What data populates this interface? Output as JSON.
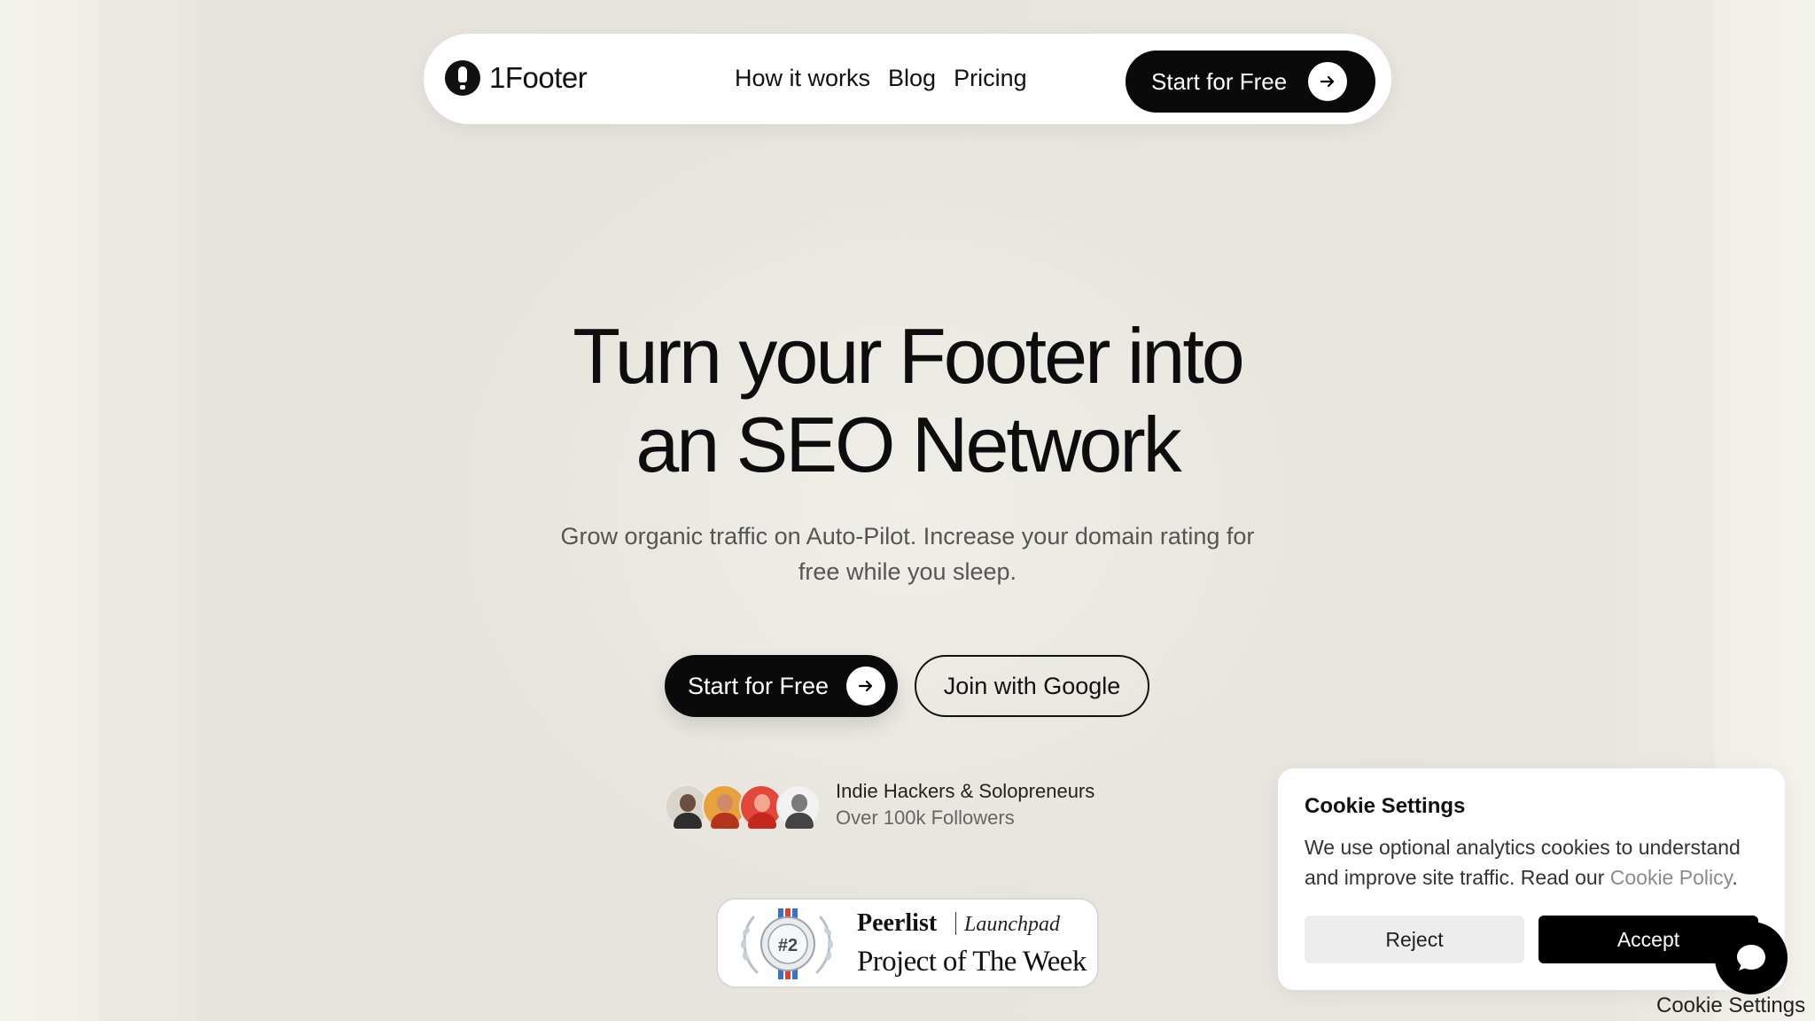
{
  "nav": {
    "logo_icon": "1footer-logo-icon",
    "brand": "1Footer",
    "links": [
      "How it works",
      "Blog",
      "Pricing"
    ],
    "cta_label": "Start for Free",
    "cta_icon": "arrow-right-icon"
  },
  "hero": {
    "title_line1": "Turn your Footer into",
    "title_line2": "an SEO Network",
    "subtitle_line1": "Grow organic traffic on Auto-Pilot. Increase your domain rating for",
    "subtitle_line2": "free while you sleep.",
    "primary_cta": "Start for Free",
    "secondary_cta": "Join with Google"
  },
  "social_proof": {
    "title": "Indie Hackers & Solopreneurs",
    "subtitle": "Over 100k Followers",
    "avatar_colors": [
      "#2e2e2e",
      "#e9a13b",
      "#e2473b",
      "#f2f2f2"
    ]
  },
  "badge": {
    "rank": "#2",
    "brand": "Peerlist",
    "launchpad": "Launchpad",
    "title": "Project of The Week"
  },
  "cookie": {
    "title": "Cookie Settings",
    "text_prefix": "We use optional analytics cookies to understand and improve site traffic. Read our ",
    "policy_link": "Cookie Policy",
    "text_suffix": ".",
    "reject_label": "Reject",
    "accept_label": "Accept",
    "settings_link": "Cookie Settings"
  },
  "colors": {
    "background": "#eceae3",
    "primary": "#0a0a0a",
    "surface": "#ffffff"
  }
}
